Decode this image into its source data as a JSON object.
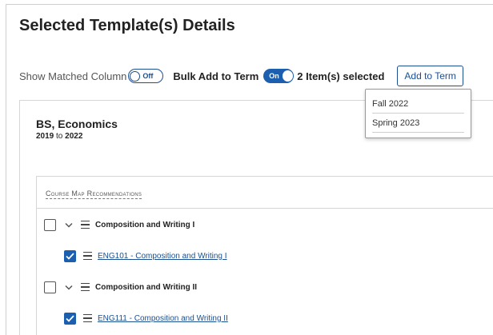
{
  "page": {
    "title": "Selected Template(s) Details"
  },
  "controls": {
    "show_matched_label": "Show Matched Column",
    "show_matched_toggle": "Off",
    "bulk_add_label": "Bulk Add to Term",
    "bulk_add_toggle": "On",
    "selected_count": "2 Item(s) selected",
    "add_to_term_label": "Add to Term"
  },
  "term_menu": {
    "options": [
      "Fall 2022",
      "Spring 2023"
    ]
  },
  "program": {
    "name": "BS, Economics",
    "start_year": "2019",
    "to_word": "to",
    "end_year": "2022"
  },
  "recommendations": {
    "header": "Course Map Recommendations",
    "rows": [
      {
        "type": "group",
        "label": "Composition and Writing I",
        "checked": false
      },
      {
        "type": "course",
        "label": "ENG101 - Composition and Writing I",
        "checked": true
      },
      {
        "type": "group",
        "label": "Composition and Writing II",
        "checked": false
      },
      {
        "type": "course",
        "label": "ENG111 - Composition and Writing II",
        "checked": true
      }
    ]
  },
  "colors": {
    "accent": "#1b5fae",
    "link": "#1b4f91"
  }
}
